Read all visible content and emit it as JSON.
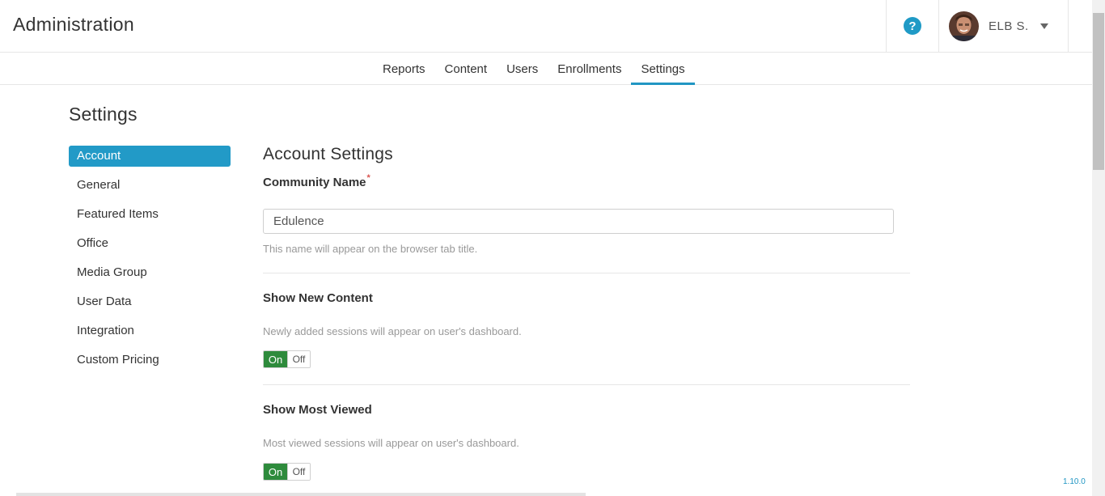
{
  "header": {
    "title": "Administration",
    "help_icon": "question-circle-icon",
    "user": {
      "name": "ELB S.",
      "avatar_icon": "user-avatar"
    }
  },
  "tabs": [
    {
      "label": "Reports",
      "active": false
    },
    {
      "label": "Content",
      "active": false
    },
    {
      "label": "Users",
      "active": false
    },
    {
      "label": "Enrollments",
      "active": false
    },
    {
      "label": "Settings",
      "active": true
    }
  ],
  "page": {
    "title": "Settings"
  },
  "side_nav": [
    {
      "label": "Account",
      "active": true
    },
    {
      "label": "General",
      "active": false
    },
    {
      "label": "Featured Items",
      "active": false
    },
    {
      "label": "Office",
      "active": false
    },
    {
      "label": "Media Group",
      "active": false
    },
    {
      "label": "User Data",
      "active": false
    },
    {
      "label": "Integration",
      "active": false
    },
    {
      "label": "Custom Pricing",
      "active": false
    }
  ],
  "account_settings": {
    "heading": "Account Settings",
    "community_name": {
      "label": "Community Name",
      "required_mark": "*",
      "value": "Edulence",
      "help": "This name will appear on the browser tab title."
    },
    "show_new_content": {
      "label": "Show New Content",
      "help": "Newly added sessions will appear on user's dashboard.",
      "on_label": "On",
      "off_label": "Off",
      "value": "On"
    },
    "show_most_viewed": {
      "label": "Show Most Viewed",
      "help": "Most viewed sessions will appear on user's dashboard.",
      "on_label": "On",
      "off_label": "Off",
      "value": "On"
    }
  },
  "footer": {
    "version": "1.10.0"
  },
  "colors": {
    "accent": "#229ac7",
    "toggle_on": "#2e8b3c",
    "required": "#d9534f"
  }
}
